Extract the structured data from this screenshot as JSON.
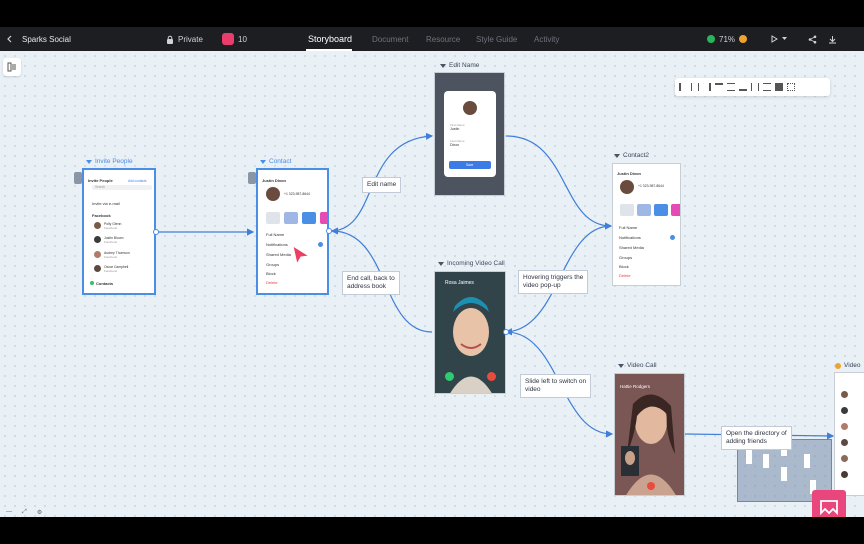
{
  "app": {
    "project_name": "Sparks Social",
    "privacy": "Private",
    "screen_count": "10",
    "progress_percent": "71%",
    "accent": "#ea3d6d",
    "brand_blue": "#4a8ee6"
  },
  "tabs": [
    {
      "label": "Storyboard",
      "active": true
    },
    {
      "label": "Document",
      "active": false
    },
    {
      "label": "Resource",
      "active": false
    },
    {
      "label": "Style Guide",
      "active": false
    },
    {
      "label": "Activity",
      "active": false
    }
  ],
  "frames": {
    "invite": {
      "label": "Invite People",
      "title": "Invite People",
      "action": "Add contacts",
      "search": "Search",
      "invite_row": "Invite via e-mail",
      "section_facebook": "Facebook",
      "people": [
        {
          "name": "Polly Glenn",
          "sub": "Facebook"
        },
        {
          "name": "Justin Bloom",
          "sub": "Facebook"
        },
        {
          "name": "Audrey Thomson",
          "sub": "Facebook"
        },
        {
          "name": "Oscar Campbell",
          "sub": "Facebook"
        }
      ],
      "section_contacts": "Contacts"
    },
    "contact": {
      "label": "Contact",
      "title": "Justin Dixon",
      "phone": "+1 323-987-8644",
      "fields": [
        "Full Name",
        "Notifications",
        "Shared Media",
        "Groups",
        "Block"
      ],
      "delete": "Delete"
    },
    "edit_name": {
      "label": "Edit Name",
      "first_label": "First Name",
      "first_value": "Justin",
      "last_label": "Last Name",
      "last_value": "Dixon",
      "save": "Save"
    },
    "contact2": {
      "label": "Contact2",
      "title": "Justin Dixon",
      "phone": "+1 323-987-8644",
      "fields": [
        "Full Name",
        "Notifications",
        "Shared Media",
        "Groups",
        "Block"
      ],
      "delete": "Delete"
    },
    "incoming": {
      "label": "Incoming Video Call",
      "caller": "Rosa Jaimes"
    },
    "video_call": {
      "label": "Video Call",
      "caller": "Hattie Rodgers"
    },
    "video3": {
      "label": "Video"
    }
  },
  "notes": {
    "edit_name": "Edit name",
    "end_call": "End call,  back to\naddress book",
    "hover": "Hovering triggers the\nvideo pop-up",
    "slide": "Slide left to switch on\nvideo",
    "open_dir": "Open the directory of\nadding friends"
  }
}
